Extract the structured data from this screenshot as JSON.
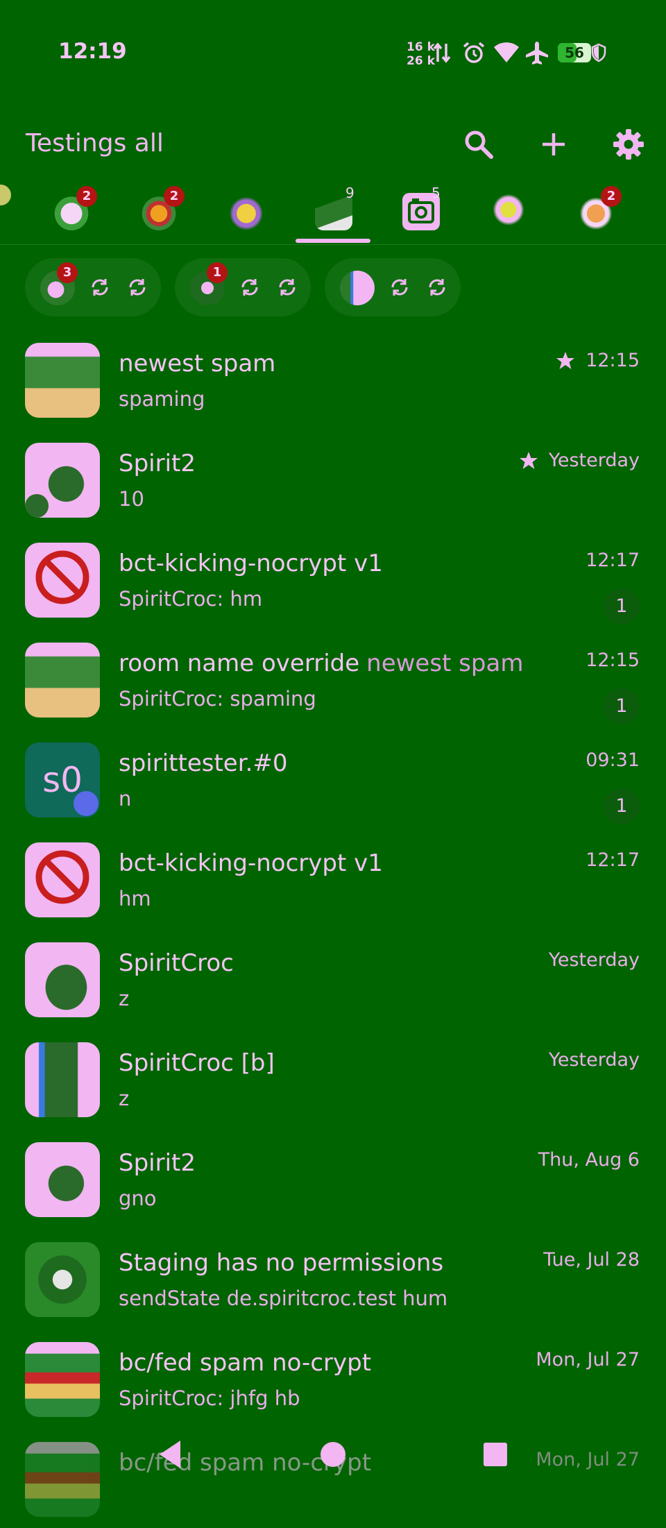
{
  "status_bar": {
    "time": "12:19",
    "net_up": "16 k",
    "net_down": "26 k",
    "battery_level": "56",
    "icons": [
      "data-transfer-icon",
      "alarm-icon",
      "wifi-icon",
      "airplane-icon",
      "battery-icon",
      "vpn-shield-icon"
    ]
  },
  "app_bar": {
    "title": "Testings all",
    "actions": [
      "search-icon",
      "plus-icon",
      "settings-gear-icon"
    ]
  },
  "space_tabs": [
    {
      "badge": "2",
      "badge_type": "red"
    },
    {
      "badge": "2",
      "badge_type": "red"
    },
    {
      "badge": "",
      "badge_type": "none"
    },
    {
      "badge": "9",
      "badge_type": "plain",
      "selected": true
    },
    {
      "badge": "5",
      "badge_type": "plain"
    },
    {
      "badge": "",
      "badge_type": "none"
    },
    {
      "badge": "2",
      "badge_type": "red"
    }
  ],
  "account_chips": [
    {
      "badge": "3"
    },
    {
      "badge": "1"
    },
    {
      "badge": ""
    }
  ],
  "rooms": [
    {
      "name": "newest spam",
      "sub": "",
      "message": "spaming",
      "time": "12:15",
      "starred": true,
      "unread": ""
    },
    {
      "name": "Spirit2",
      "sub": "",
      "message": "10",
      "time": "Yesterday",
      "starred": true,
      "unread": ""
    },
    {
      "name": "bct-kicking-nocrypt v1",
      "sub": "",
      "message": "SpiritCroc: hm",
      "time": "12:17",
      "starred": false,
      "unread": "1"
    },
    {
      "name": "room name override",
      "sub": "newest spam",
      "message": "SpiritCroc: spaming",
      "time": "12:15",
      "starred": false,
      "unread": "1"
    },
    {
      "name": "spirittester.#0",
      "sub": "",
      "message": "n",
      "time": "09:31",
      "starred": false,
      "unread": "1",
      "avatar_text": "s0"
    },
    {
      "name": "bct-kicking-nocrypt v1",
      "sub": "",
      "message": "hm",
      "time": "12:17",
      "starred": false,
      "unread": ""
    },
    {
      "name": "SpiritCroc",
      "sub": "",
      "message": "z",
      "time": "Yesterday",
      "starred": false,
      "unread": ""
    },
    {
      "name": "SpiritCroc [b]",
      "sub": "",
      "message": "z",
      "time": "Yesterday",
      "starred": false,
      "unread": ""
    },
    {
      "name": "Spirit2",
      "sub": "",
      "message": "gno",
      "time": "Thu, Aug 6",
      "starred": false,
      "unread": ""
    },
    {
      "name": "Staging has no permissions",
      "sub": "",
      "message": "sendState de.spiritcroc.test hum",
      "time": "Tue, Jul 28",
      "starred": false,
      "unread": ""
    },
    {
      "name": "bc/fed spam no-crypt",
      "sub": "",
      "message": "SpiritCroc: jhfg hb",
      "time": "Mon, Jul 27",
      "starred": false,
      "unread": ""
    },
    {
      "name": "bc/fed spam no-crypt",
      "sub": "",
      "message": "",
      "time": "Mon, Jul 27",
      "starred": false,
      "unread": ""
    }
  ],
  "colors": {
    "background": "#006400",
    "accent": "#f2b6f2",
    "badge_red": "#b41414"
  }
}
